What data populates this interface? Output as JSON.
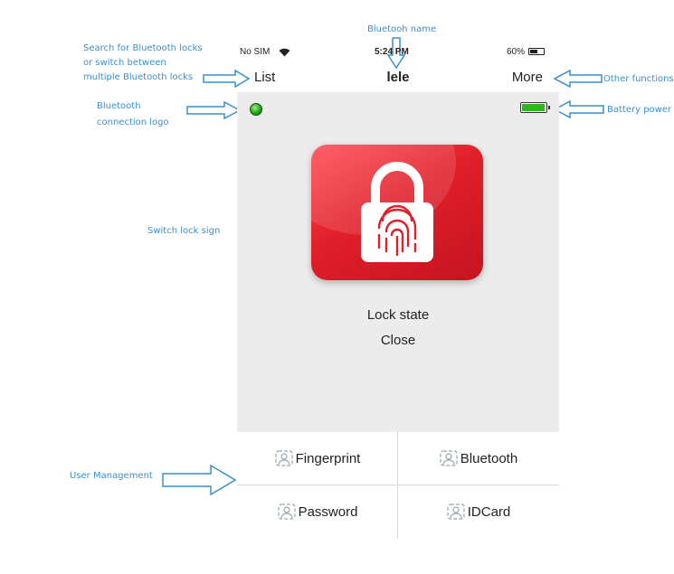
{
  "annotations": {
    "bluetooth_name": "Bluetooh name",
    "search_line1": "Search for Bluetooth locks",
    "search_line2": "or switch between",
    "search_line3": "multiple Bluetooth locks",
    "other_functions": "Other functions",
    "connection_line1": "Bluetooth",
    "connection_line2": "connection logo",
    "battery_power": "Battery power",
    "switch_lock": "Switch lock sign",
    "user_management": "User Management"
  },
  "status_bar": {
    "carrier": "No SIM",
    "wifi_icon": "wifi-icon",
    "time": "5:24 PM",
    "battery": "60%",
    "battery_level": 0.6
  },
  "nav": {
    "list_label": "List",
    "title": "lele",
    "more_label": "More"
  },
  "screen": {
    "connection_status": "connected",
    "battery_level": 0.9,
    "lock_state_label": "Lock state",
    "lock_state_value": "Close"
  },
  "users": {
    "fingerprint": "Fingerprint",
    "bluetooth": "Bluetooth",
    "password": "Password",
    "idcard": "IDCard"
  },
  "colors": {
    "accent": "#3a8fd0",
    "lock_red": "#e01f2a",
    "led_green": "#1e9e12"
  }
}
